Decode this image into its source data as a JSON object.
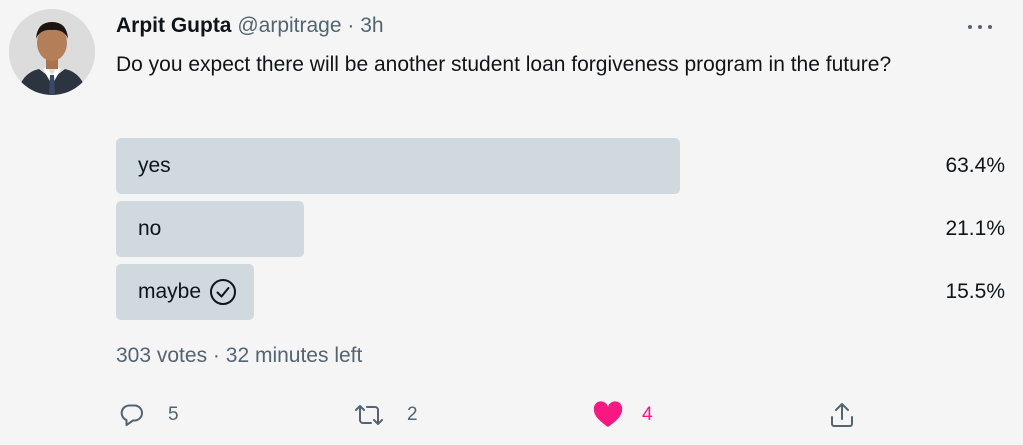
{
  "tweet": {
    "author_name": "Arpit Gupta",
    "handle": "@arpitrage",
    "separator": "·",
    "time": "3h",
    "text": "Do you expect there will be another student loan forgiveness program in the future?"
  },
  "poll": {
    "options": [
      {
        "label": "yes",
        "percent": "63.4%",
        "fraction": 0.634,
        "selected": false
      },
      {
        "label": "no",
        "percent": "21.1%",
        "fraction": 0.211,
        "selected": false
      },
      {
        "label": "maybe",
        "percent": "15.5%",
        "fraction": 0.155,
        "selected": true
      }
    ],
    "votes": "303 votes",
    "separator": "·",
    "time_left": "32 minutes left"
  },
  "actions": {
    "reply_count": "5",
    "retweet_count": "2",
    "like_count": "4"
  },
  "icons": {
    "more": "more-horizontal-icon",
    "reply": "reply-icon",
    "retweet": "retweet-icon",
    "like": "heart-icon",
    "share": "share-icon",
    "selected": "check-circle-icon"
  },
  "colors": {
    "background": "#f5f5f5",
    "bar": "#cfd9de",
    "text": "#0f1419",
    "secondary": "#536471",
    "like": "#f91880"
  }
}
